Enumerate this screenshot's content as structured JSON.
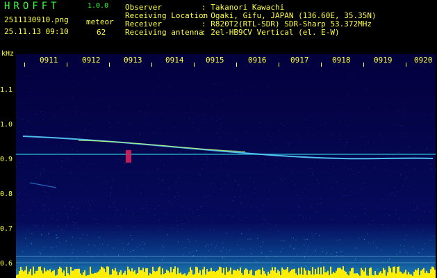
{
  "app": {
    "title": "HROFFT",
    "version": "1.0.0"
  },
  "file": {
    "name": "2511130910.png",
    "datetime": "25.11.13 09:10"
  },
  "meteor": {
    "label": "meteor",
    "count": "62"
  },
  "info": [
    {
      "label": "Observer",
      "value": ": Takanori Kawachi"
    },
    {
      "label": "Receiving Location",
      "value": ": Ogaki, Gifu, JAPAN (136.60E, 35.35N)"
    },
    {
      "label": "Receiver",
      "value": ": R820T2(RTL-SDR) SDR-Sharp 53.372MHz"
    },
    {
      "label": "Receiving antenna",
      "value": ": 2el-HB9CV Vertical (el. E-W)"
    }
  ],
  "axis": {
    "y_unit": "kHz",
    "y_labels": [
      "1.1",
      "1.0",
      "0.9",
      "0.8",
      "0.7",
      "0.6"
    ],
    "x_labels": [
      "0911",
      "0912",
      "0913",
      "0914",
      "0915",
      "0916",
      "0917",
      "0918",
      "0919",
      "0920"
    ]
  },
  "colors": {
    "text": "#ffff44",
    "title": "#33ff33",
    "background": "#03003d"
  }
}
